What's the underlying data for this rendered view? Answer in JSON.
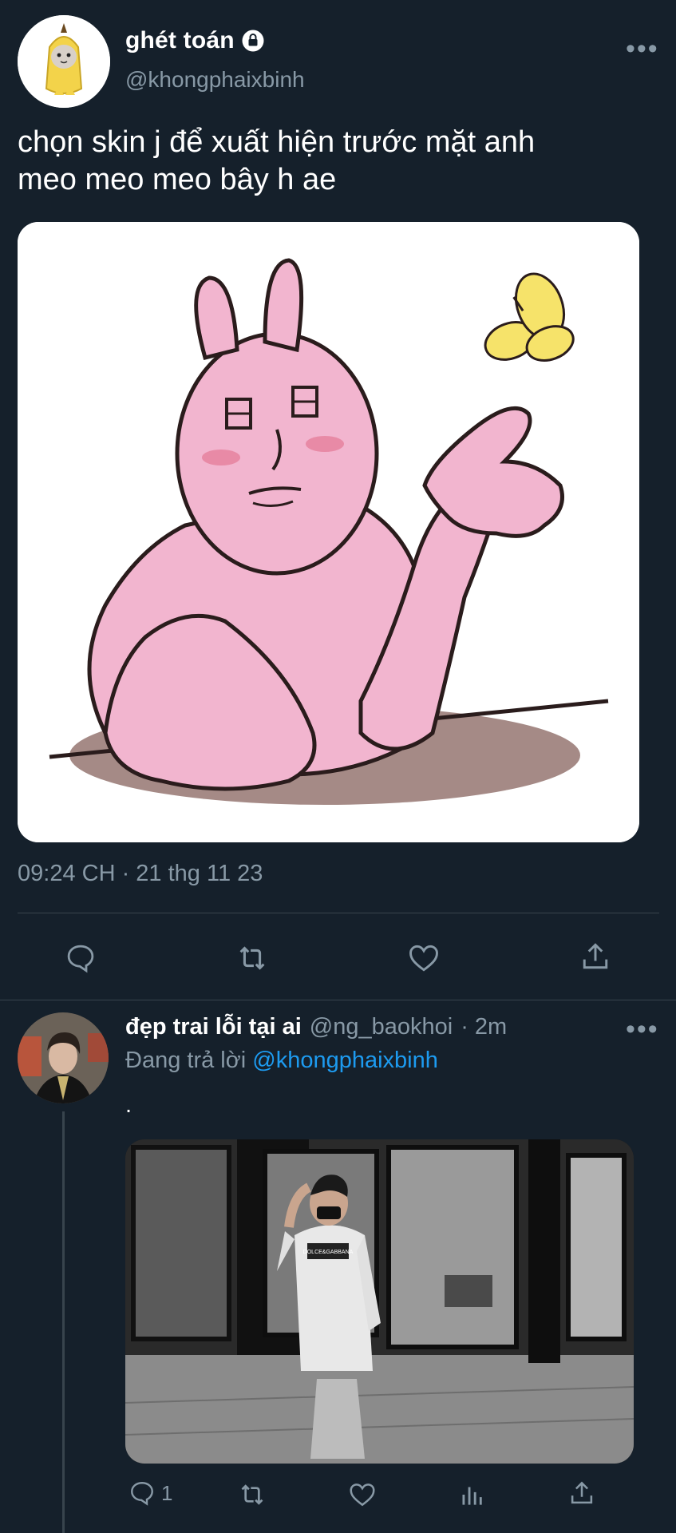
{
  "main_tweet": {
    "display_name": "ghét toán",
    "handle": "@khongphaixbinh",
    "text_line1": "chọn skin j để xuất hiện trước mặt anh",
    "text_line2": "meo meo meo bây h ae",
    "timestamp": "09:24 CH · 21 thg 11 23",
    "more_label": "•••"
  },
  "reply": {
    "display_name": "đẹp trai lỗi tại ai",
    "handle": "@ng_baokhoi",
    "time_ago": "· 2m",
    "replying_prefix": "Đang trả lời",
    "replying_to": "@khongphaixbinh",
    "text": ".",
    "reply_count": "1",
    "more_label": "•••",
    "shirt_text": "DOLCE&GABBANA"
  },
  "icons": [
    "lock-icon",
    "more-icon",
    "reply-icon",
    "retweet-icon",
    "like-icon",
    "share-icon",
    "analytics-icon"
  ],
  "colors": {
    "background": "#15202b",
    "secondary_text": "#8899a6",
    "link": "#1d9bf0",
    "divider": "#38444d"
  }
}
